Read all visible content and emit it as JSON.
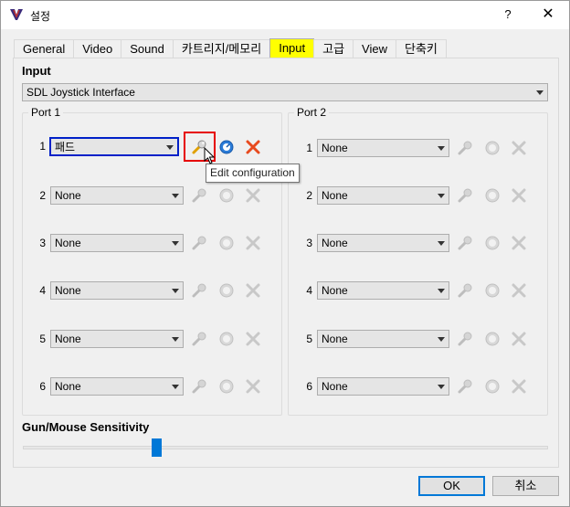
{
  "window": {
    "title": "설정",
    "help": "?",
    "close": "✕"
  },
  "tabs": [
    {
      "label": "General"
    },
    {
      "label": "Video"
    },
    {
      "label": "Sound"
    },
    {
      "label": "카트리지/메모리"
    },
    {
      "label": "Input",
      "active": true
    },
    {
      "label": "고급"
    },
    {
      "label": "View"
    },
    {
      "label": "단축키"
    }
  ],
  "input": {
    "heading": "Input",
    "interface": "SDL Joystick Interface",
    "port1": {
      "title": "Port 1",
      "rows": [
        {
          "num": "1",
          "value": "패드"
        },
        {
          "num": "2",
          "value": "None"
        },
        {
          "num": "3",
          "value": "None"
        },
        {
          "num": "4",
          "value": "None"
        },
        {
          "num": "5",
          "value": "None"
        },
        {
          "num": "6",
          "value": "None"
        }
      ]
    },
    "port2": {
      "title": "Port 2",
      "rows": [
        {
          "num": "1",
          "value": "None"
        },
        {
          "num": "2",
          "value": "None"
        },
        {
          "num": "3",
          "value": "None"
        },
        {
          "num": "4",
          "value": "None"
        },
        {
          "num": "5",
          "value": "None"
        },
        {
          "num": "6",
          "value": "None"
        }
      ]
    },
    "tooltip": "Edit configuration"
  },
  "sensitivity": {
    "label": "Gun/Mouse Sensitivity",
    "value_fraction": 0.25
  },
  "buttons": {
    "ok": "OK",
    "cancel": "취소"
  },
  "colors": {
    "active_tab": "#ffff00",
    "highlight_blue": "#0020c8",
    "highlight_red": "#e60000",
    "accent": "#0078d7"
  },
  "icons": {
    "wrench": "wrench-icon",
    "gauge": "gauge-icon",
    "remove": "close-x-icon"
  }
}
